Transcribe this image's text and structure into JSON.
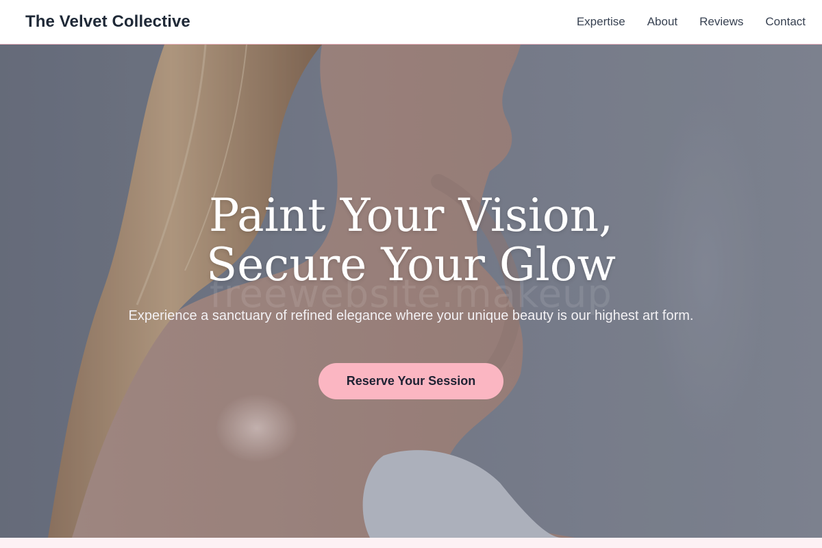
{
  "nav": {
    "brand": "The Velvet Collective",
    "links": [
      "Expertise",
      "About",
      "Reviews",
      "Contact"
    ]
  },
  "hero": {
    "headline_line1": "Paint Your Vision,",
    "headline_line2": "Secure Your Glow",
    "subtext": "Experience a sanctuary of refined elegance where your unique beauty is our highest art form.",
    "cta_label": "Reserve Your Session",
    "watermark": "freewebsite.makeup"
  },
  "colors": {
    "accent": "#fbb6c2",
    "nav_border": "#f3b3c0",
    "footer_strip": "#fdf1f4",
    "brand_text": "#1f2937"
  }
}
